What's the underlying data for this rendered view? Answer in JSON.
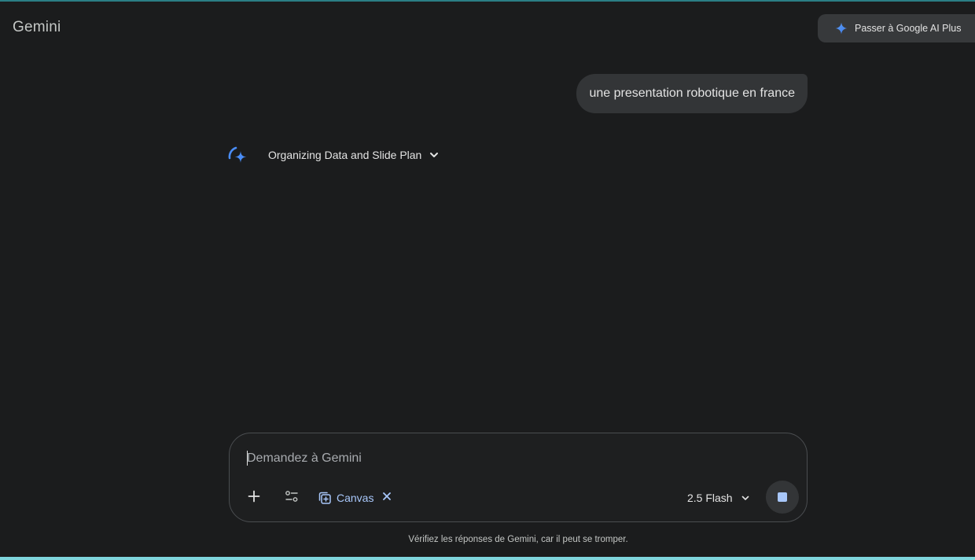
{
  "app": {
    "brand": "Gemini",
    "upgrade_button": "Passer à Google AI Plus"
  },
  "conversation": {
    "user_message": "une presentation robotique en france",
    "thinking_status": "Organizing Data and Slide Plan"
  },
  "composer": {
    "placeholder": "Demandez à Gemini",
    "value": "",
    "canvas_label": "Canvas",
    "model_label": "2.5 Flash"
  },
  "footer": {
    "disclaimer": "Vérifiez les réponses de Gemini, car il peut se tromper."
  },
  "icons": {
    "upgrade": "sparkle-icon",
    "assistant": "gemini-spark-icon",
    "expand": "chevron-down-icon",
    "add": "plus-icon",
    "tools": "tools-sliders-icon",
    "canvas": "canvas-icon",
    "remove": "close-icon",
    "stop": "stop-icon"
  },
  "colors": {
    "background": "#1b1c1d",
    "bubble": "#333537",
    "accent_blue": "#a8c7fa",
    "spark_blue": "#4a8df7"
  }
}
